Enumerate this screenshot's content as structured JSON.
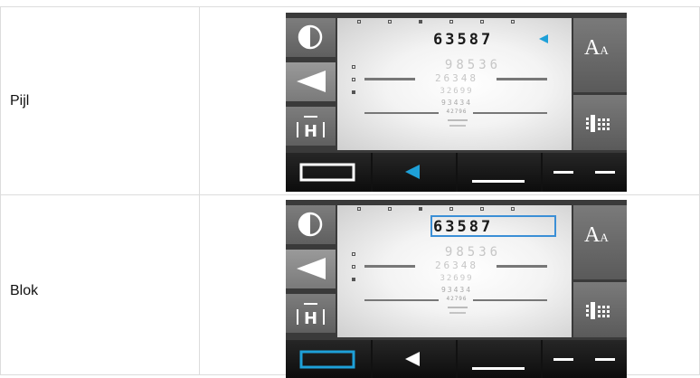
{
  "rows": [
    {
      "label": "Pijl",
      "selected_mode": "arrow",
      "screen": {
        "top_line": "63587",
        "line2": "98536",
        "line3": "26348",
        "line4": "32699",
        "line5": "93434",
        "line6": "42796"
      },
      "icons": {
        "contrast": "contrast-icon",
        "arrow": "arrow-left-icon",
        "letter_frame": "letter-frame-icon",
        "font_size": "font-size-icon",
        "chart_grid": "chart-grid-icon",
        "rectangle": "rectangle-frame-icon",
        "pointer": "pointer-arrow-icon",
        "underline": "underline-icon",
        "dashes": "dashes-icon"
      }
    },
    {
      "label": "Blok",
      "selected_mode": "block",
      "screen": {
        "top_line": "63587",
        "line2": "98536",
        "line3": "26348",
        "line4": "32699",
        "line5": "93434",
        "line6": "42796"
      }
    }
  ],
  "colors": {
    "accent": "#1ea0d8",
    "highlight_box": "#3b8fd6",
    "grid_line": "#dcdcdc"
  },
  "logo_text": {
    "font_size_button": "AA",
    "letter_frame": "H"
  }
}
